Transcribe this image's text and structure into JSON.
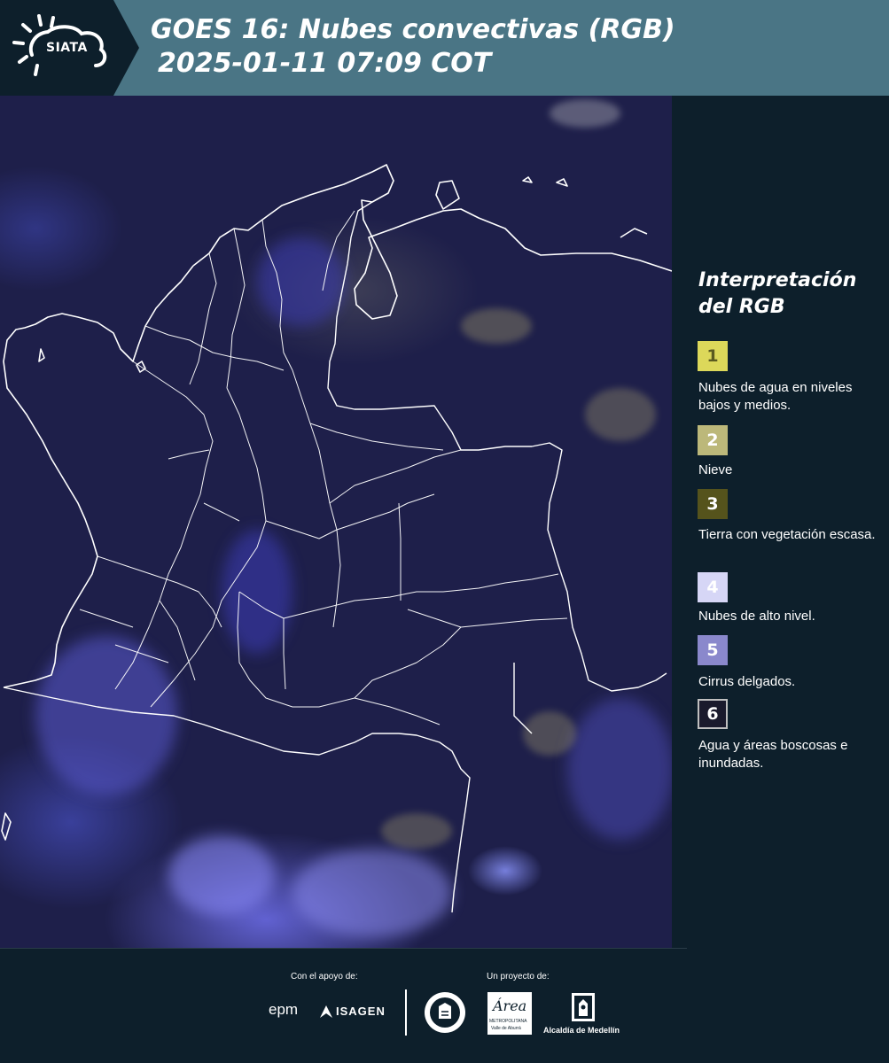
{
  "header": {
    "logo_text": "SIATA",
    "title_line1": "GOES 16: Nubes convectivas (RGB)",
    "title_line2": "2025-01-11 07:09 COT"
  },
  "legend": {
    "title": "Interpretación del RGB",
    "items": [
      {
        "num": "1",
        "label": "Nubes de agua en niveles bajos y medios.",
        "color": "#dcd85a"
      },
      {
        "num": "2",
        "label": "Nieve",
        "color": "#bcb87a"
      },
      {
        "num": "3",
        "label": "Tierra con vegetación escasa.",
        "color": "#55531c"
      },
      {
        "num": "4",
        "label": "Nubes de alto nivel.",
        "color": "#d6d6f6"
      },
      {
        "num": "5",
        "label": "Cirrus delgados.",
        "color": "#8a88cc"
      },
      {
        "num": "6",
        "label": "Agua y áreas boscosas e inundadas.",
        "color": "#1a1a2c"
      }
    ]
  },
  "footer": {
    "support_label": "Con el apoyo de:",
    "project_label": "Un proyecto de:",
    "epm": "epm",
    "isagen": "ISAGEN",
    "area_name": "Área",
    "area_sub1": "METROPOLITANA",
    "area_sub2": "Valle de Aburrá",
    "alcaldia": "Alcaldía de Medellín"
  }
}
